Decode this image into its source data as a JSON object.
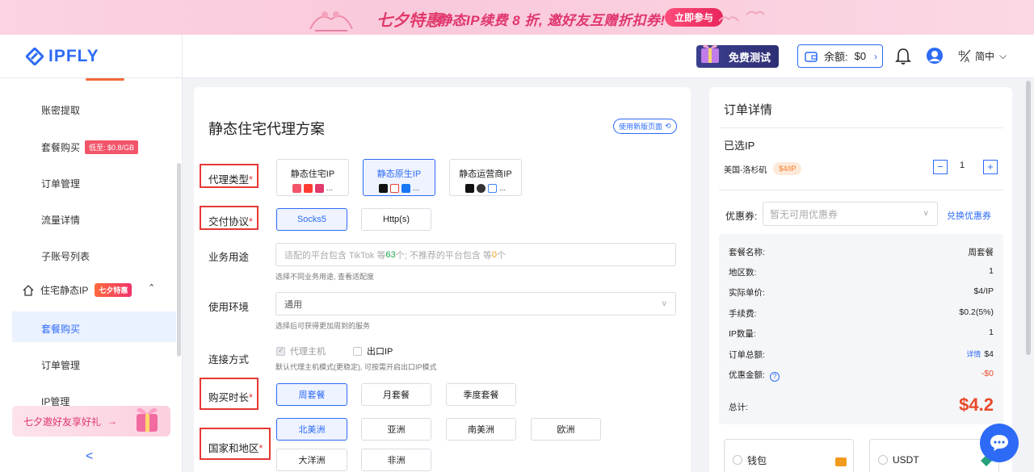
{
  "banner": {
    "brand": "七夕特惠",
    "text": "静态IP续费 8 折, 邀好友互赠折扣券!",
    "button": "立即参与"
  },
  "logo": {
    "text": "IPFLY"
  },
  "topbar": {
    "free_test": "免费测试",
    "balance_label": "余额:",
    "balance_value": "$0",
    "lang": "简中"
  },
  "sidebar": {
    "items": [
      {
        "label": "账密提取"
      },
      {
        "label": "套餐购买",
        "tag": "低至: $0.8/GB"
      },
      {
        "label": "订单管理"
      },
      {
        "label": "流量详情"
      },
      {
        "label": "子账号列表"
      }
    ],
    "section": {
      "label": "住宅静态IP",
      "tag": "七夕特惠"
    },
    "sub_items": [
      {
        "label": "套餐购买"
      },
      {
        "label": "订单管理"
      },
      {
        "label": "IP管理"
      }
    ],
    "promo": "七夕邀好友享好礼",
    "collapse_icon": "chevron-left"
  },
  "main": {
    "title": "静态住宅代理方案",
    "new_version": "使用新版页面",
    "labels": {
      "proxy_type": "代理类型",
      "protocol": "交付协议",
      "usage": "业务用途",
      "env": "使用环境",
      "connection": "连接方式",
      "duration": "购买时长",
      "region": "国家和地区"
    },
    "proxy_types": [
      {
        "label": "静态住宅IP",
        "icons": [
          "weibo",
          "red",
          "love",
          "bilibili",
          "..."
        ],
        "more": "..."
      },
      {
        "label": "静态原生IP",
        "more": "...",
        "selected": true
      },
      {
        "label": "静态运营商IP",
        "more": "..."
      }
    ],
    "protocols": [
      {
        "label": "Socks5",
        "selected": true
      },
      {
        "label": "Http(s)"
      }
    ],
    "usage": {
      "placeholder_a": "适配的平台包含 TikTok 等 ",
      "count_a": "63",
      "placeholder_b": "个; 不推荐的平台包含 等 ",
      "count_b": "0",
      "placeholder_c": "个",
      "hint": "选择不同业务用途, 查看适配度"
    },
    "env": {
      "value": "通用",
      "hint": "选择后可获得更加周到的服务"
    },
    "connection": {
      "opt1": "代理主机",
      "opt2": "出口IP",
      "hint": "默认代理主机模式(更稳定), 可按需开启出口IP模式"
    },
    "durations": [
      {
        "label": "周套餐",
        "selected": true
      },
      {
        "label": "月套餐"
      },
      {
        "label": "季度套餐"
      }
    ],
    "regions": [
      {
        "label": "北美洲",
        "selected": true
      },
      {
        "label": "亚洲"
      },
      {
        "label": "南美洲"
      },
      {
        "label": "欧洲"
      },
      {
        "label": "大洋洲"
      },
      {
        "label": "非洲"
      }
    ]
  },
  "order": {
    "title": "订单详情",
    "selected_ip": "已选IP",
    "location": "美国-洛杉矶",
    "price_tag": "$4/IP",
    "quantity": "1",
    "coupon_label": "优惠券:",
    "coupon_placeholder": "暂无可用优惠券",
    "coupon_link": "兑换优惠券",
    "summary": [
      {
        "k": "套餐名称:",
        "v": "周套餐"
      },
      {
        "k": "地区数:",
        "v": "1"
      },
      {
        "k": "实际单价:",
        "v": "$4/IP"
      },
      {
        "k": "手续费:",
        "v": "$0.2(5%)"
      },
      {
        "k": "IP数量:",
        "v": "1"
      },
      {
        "k": "订单总额:",
        "v": "$4",
        "detail": "详情"
      },
      {
        "k": "优惠金额:",
        "v": "-$0"
      }
    ],
    "total_label": "总计:",
    "total_value": "$4.2",
    "payments": [
      {
        "label": "钱包"
      },
      {
        "label": "USDT"
      }
    ]
  },
  "colors": {
    "accent": "#2d6bf6",
    "danger": "#e53935",
    "price": "#e84a2c"
  }
}
